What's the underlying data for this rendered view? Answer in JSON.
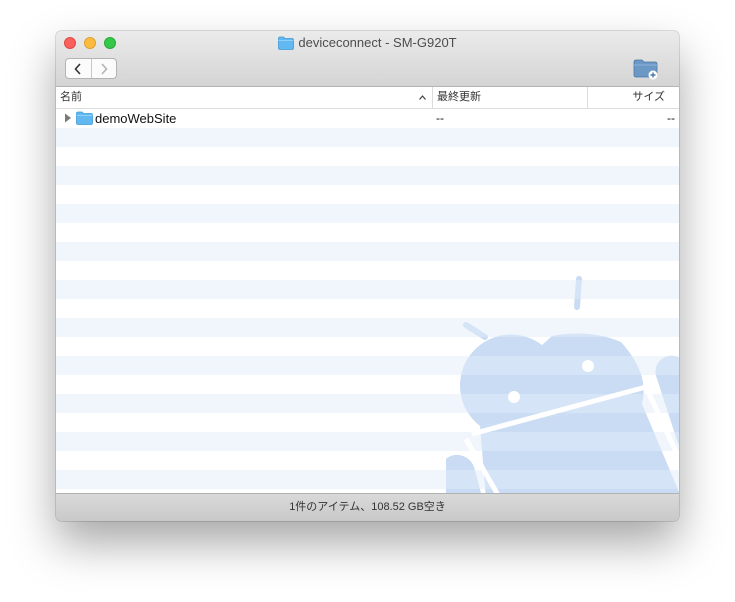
{
  "window": {
    "title": "deviceconnect - SM-G920T"
  },
  "toolbar": {
    "back_icon": "chevron-left-icon",
    "forward_icon": "chevron-right-icon",
    "new_folder_icon": "new-folder-icon"
  },
  "columns": {
    "name": "名前",
    "date": "最終更新",
    "size": "サイズ",
    "sort_icon": "chevron-up-icon"
  },
  "files": [
    {
      "name": "demoWebSite",
      "date": "--",
      "size": "--",
      "type": "folder",
      "expanded": false
    }
  ],
  "status": {
    "text": "1件のアイテム、108.52 GB空き"
  },
  "colors": {
    "stripe": "#edf3fc",
    "android_watermark": "#c9dcf3",
    "folder": "#62b8f0"
  }
}
